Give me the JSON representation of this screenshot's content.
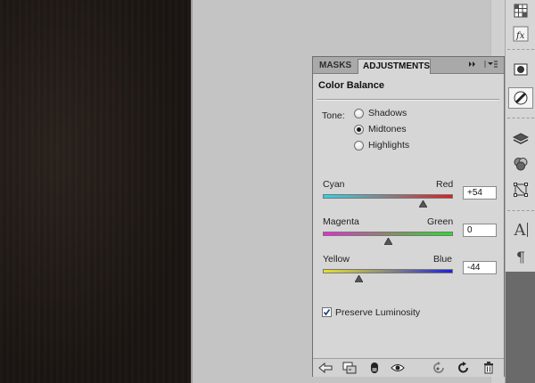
{
  "panel": {
    "tabs": [
      {
        "label": "MASKS",
        "active": false
      },
      {
        "label": "ADJUSTMENTS",
        "active": true
      }
    ],
    "title": "Color Balance",
    "tone": {
      "label": "Tone:",
      "options": [
        {
          "label": "Shadows",
          "selected": false
        },
        {
          "label": "Midtones",
          "selected": true
        },
        {
          "label": "Highlights",
          "selected": false
        }
      ]
    },
    "sliders": [
      {
        "left": "Cyan",
        "right": "Red",
        "value": "+54",
        "amount": 54,
        "min": -100,
        "max": 100
      },
      {
        "left": "Magenta",
        "right": "Green",
        "value": "0",
        "amount": 0,
        "min": -100,
        "max": 100
      },
      {
        "left": "Yellow",
        "right": "Blue",
        "value": "-44",
        "amount": -44,
        "min": -100,
        "max": 100
      }
    ],
    "preserve_luminosity": {
      "label": "Preserve Luminosity",
      "checked": true
    }
  },
  "icons": {
    "tab_controls": [
      "double-arrow-icon",
      "panel-menu-icon"
    ],
    "right_dock": [
      "swatches-grid-icon",
      "fx-styles-icon",
      "mask-icon",
      "adjustments-icon",
      "layers-icon",
      "channels-icon",
      "paths-icon",
      "character-icon",
      "paragraph-icon"
    ],
    "footer": [
      "back-arrow-icon",
      "clip-to-layer-icon",
      "layer-visibility-toggle-icon",
      "eye-icon",
      "reset-icon",
      "refresh-icon",
      "trash-icon"
    ]
  },
  "glyphs": {
    "fx": "fx",
    "character": "A",
    "paragraph": "¶"
  },
  "colors": {
    "panel_bg": "#d6d6d6",
    "tab_bar": "#a9a9a9",
    "workspace": "#c4c4c4",
    "canvas": "#1b1512"
  }
}
